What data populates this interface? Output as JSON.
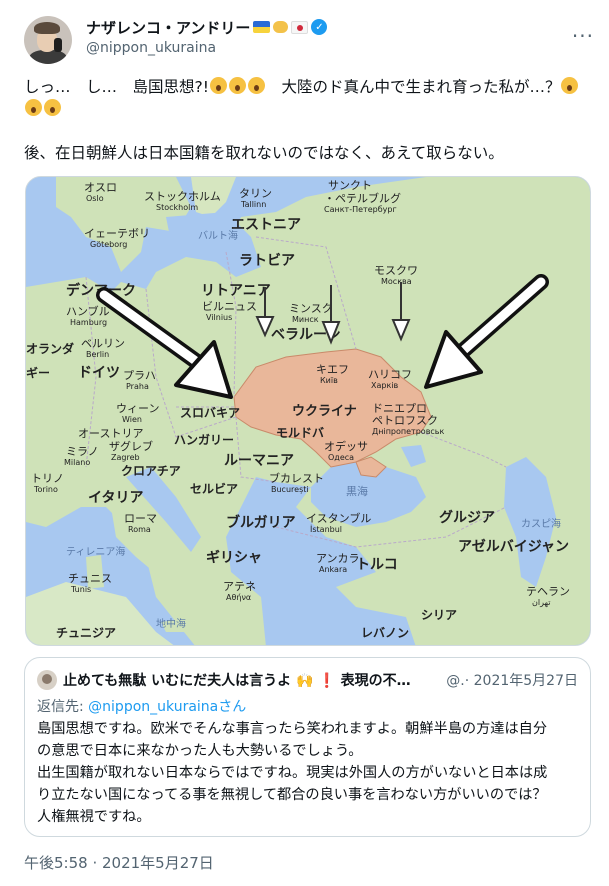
{
  "author": {
    "display_name": "ナザレンコ・アンドリー",
    "handle": "@nippon_ukuraina",
    "emoji_icons": [
      "ukraine-flag-icon",
      "handshake-icon",
      "japan-flag-icon"
    ],
    "verified": true
  },
  "tweet": {
    "line1": "しっ…　し…　島国思想?!",
    "line1_emoji_count": 3,
    "line1_b": "　大陸のド真ん中で生まれ育った私が…？",
    "line1_b_emoji_count": 3,
    "line2": "後、在日朝鮮人は日本国籍を取れないのではなく、あえて取らない。"
  },
  "map": {
    "labels": {
      "oslo": "オスロ",
      "oslo_en": "Oslo",
      "stockholm": "ストックホルム",
      "stockholm_en": "Stockholm",
      "tallinn": "タリン",
      "tallinn_en": "Tallinn",
      "spb": "サンクト\nペテルブルグ",
      "spb_1": "サンクト",
      "spb_2": "・ペテルブルグ",
      "spb_ru": "Санкт-Петербург",
      "goteborg": "イェーテボリ",
      "goteborg_en": "Göteborg",
      "baltic": "バルト海",
      "estonia": "エストニア",
      "latvia": "ラトビア",
      "moscow": "モスクワ",
      "moscow_ru": "Москва",
      "denmark": "デンマーク",
      "hamburg": "ハンブル",
      "hamburg_en": "Hamburg",
      "lithuania": "リトアニア",
      "vilnius": "ビルニュス",
      "vilnius_en": "Vilnius",
      "minsk": "ミンスク",
      "minsk_ru": "Минск",
      "belarus": "ベラルーシ",
      "netherlands": "オランダ",
      "berlin": "ベルリン",
      "berlin_en": "Berlin",
      "germany": "ドイツ",
      "prague": "プラハ",
      "prague_en": "Praha",
      "kyiv": "キエフ",
      "kyiv_ru": "Київ",
      "kharkiv": "ハリコフ",
      "kharkiv_ru": "Харків",
      "ukraine": "ウクライナ",
      "belgium": "ギー",
      "vienna": "ウィーン",
      "vienna_en": "Wien",
      "slovakia": "スロバキア",
      "dnipro": "ドニエプロ\nペトロフスク",
      "dnipro_1": "ドニエプロ",
      "dnipro_2": "ペトロフスク",
      "dnipro_ru": "Дніпропетровськ",
      "austria": "オーストリア",
      "zagreb": "ザグレブ",
      "zagreb_en": "Zagreb",
      "hungary": "ハンガリー",
      "moldova": "モルドバ",
      "milan": "ミラノ",
      "milan_en": "Milano",
      "croatia": "クロアチア",
      "odessa": "オデッサ",
      "odessa_ru": "Одеса",
      "romania": "ルーマニア",
      "torino": "トリノ",
      "torino_en": "Torino",
      "serbia": "セルビア",
      "bucharest": "ブカレスト",
      "bucharest_en": "București",
      "black_sea": "黒海",
      "italy": "イタリア",
      "rome": "ローマ",
      "rome_en": "Roma",
      "bulgaria": "ブルガリア",
      "istanbul": "イスタンブル",
      "istanbul_en": "İstanbul",
      "georgia": "グルジア",
      "caspian": "カスピ海",
      "tyrrhenian": "ティレニア海",
      "greece": "ギリシャ",
      "ankara": "アンカラ",
      "ankara_en": "Ankara",
      "turkey": "トルコ",
      "azerbaijan": "アゼルバイジャン",
      "tunis": "チュニス",
      "tunis_en": "Tunis",
      "athens": "アテネ",
      "athens_en": "Αθήνα",
      "tehran": "テヘラン",
      "tehran_en": "تهران",
      "syria": "シリア",
      "tunisia": "チュニジア",
      "mediterranean": "地中海",
      "lebanon": "レバノン"
    }
  },
  "quote": {
    "name": "止めても無駄 いむにだ夫人は言うよ",
    "name_suffix": "❗ 表現の不…",
    "handle_date": "@.· 2021年5月27日",
    "reply_prefix": "返信先: ",
    "reply_mention": "@nippon_ukurainaさん",
    "body": [
      "島国思想ですね。欧米でそんな事言ったら笑われますよ。朝鮮半島の方達は自分",
      "の意思で日本に来なかった人も大勢いるでしょう。",
      "出生国籍が取れない日本ならではですね。現実は外国人の方がいないと日本は成",
      "り立たない国になってる事を無視して都合の良い事を言わない方がいいのでは？",
      "人権無視ですね。"
    ]
  },
  "timestamp": "午後5:58 · 2021年5月27日",
  "colors": {
    "text": "#0f1419",
    "secondary": "#536471",
    "link": "#1d9bf0",
    "ukraine_highlight": "#e9b79a",
    "sea": "#a8c8f0",
    "land": "#cfe2b8"
  }
}
